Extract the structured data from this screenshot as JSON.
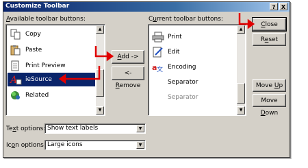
{
  "window": {
    "title": "Customize Toolbar",
    "help_glyph": "?",
    "close_glyph": "X"
  },
  "left_panel": {
    "label": "Available toolbar buttons:",
    "items": [
      {
        "label": "Copy",
        "icon": "copy-icon"
      },
      {
        "label": "Paste",
        "icon": "paste-icon"
      },
      {
        "label": "Print Preview",
        "icon": "print-preview-icon"
      },
      {
        "label": "ieSource",
        "icon": "iesource-icon",
        "selected": true
      },
      {
        "label": "Related",
        "icon": "related-icon"
      }
    ]
  },
  "right_panel": {
    "label": "Current toolbar buttons:",
    "items": [
      {
        "label": "Print",
        "icon": "print-icon"
      },
      {
        "label": "Edit",
        "icon": "edit-icon"
      },
      {
        "label": "Encoding",
        "icon": "encoding-icon"
      },
      {
        "label": "Separator",
        "icon": ""
      },
      {
        "label": "Separator",
        "icon": "",
        "dim": true
      }
    ]
  },
  "buttons": {
    "add": {
      "pre": "",
      "u": "A",
      "post": "dd ->"
    },
    "remove": {
      "pre": "<- ",
      "u": "R",
      "post": "emove"
    },
    "close": {
      "pre": "",
      "u": "C",
      "post": "lose"
    },
    "reset": {
      "pre": "R",
      "u": "e",
      "post": "set"
    },
    "move_up": {
      "pre": "Move ",
      "u": "U",
      "post": "p"
    },
    "move_down": {
      "pre": "Move ",
      "u": "D",
      "post": "own"
    }
  },
  "options": {
    "text": {
      "pre": "Te",
      "u": "x",
      "post": "t options:",
      "value": "Show text labels"
    },
    "icon": {
      "pre": "Ic",
      "u": "o",
      "post": "n options:",
      "value": "Large icons"
    }
  },
  "annotation_color": "#e00000"
}
